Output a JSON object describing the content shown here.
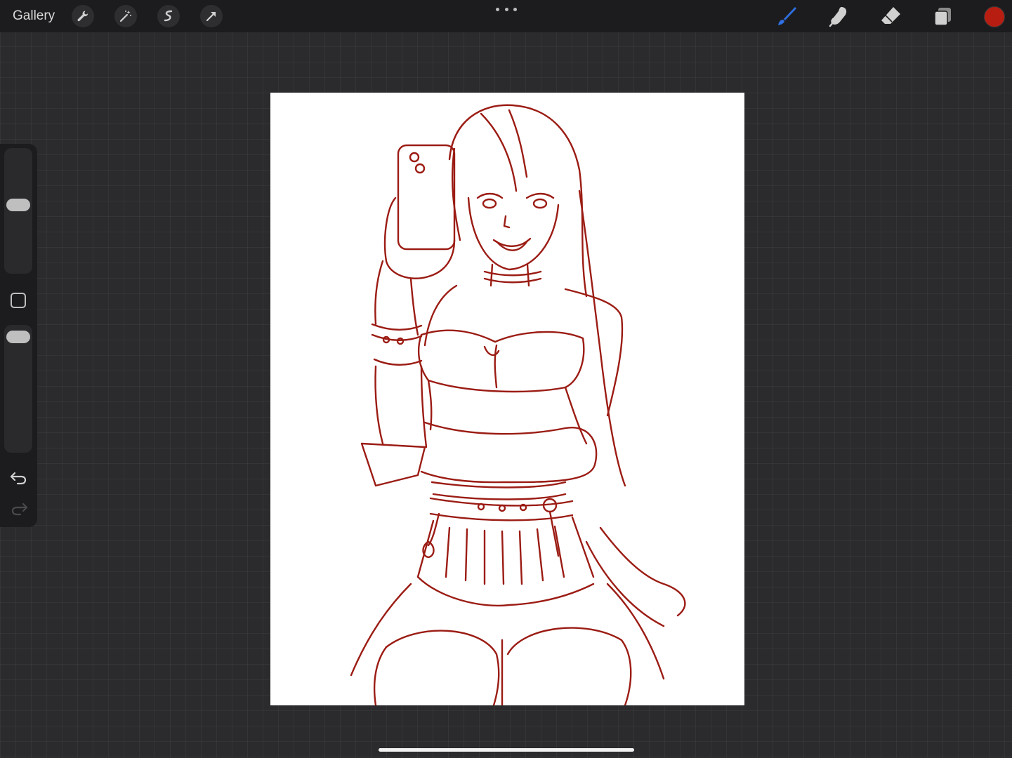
{
  "app": {
    "gallery_label": "Gallery"
  },
  "toolbar_left": {
    "icons": [
      "wrench-icon",
      "magic-wand-icon",
      "selection-icon",
      "transform-arrow-icon"
    ]
  },
  "toolbar_right": {
    "icons": [
      "brush-icon",
      "smudge-icon",
      "eraser-icon",
      "layers-icon"
    ],
    "active_tool": "brush-icon",
    "active_tool_color": "#2f6fe0",
    "current_color": "#b81d12"
  },
  "sidebar": {
    "brush_size_level": 0.55,
    "opacity_level": 0.95,
    "icons": [
      "undo-icon",
      "redo-icon"
    ]
  },
  "canvas": {
    "background": "#ffffff",
    "stroke_color": "#9b1c14",
    "content": "sketch-drawing"
  }
}
